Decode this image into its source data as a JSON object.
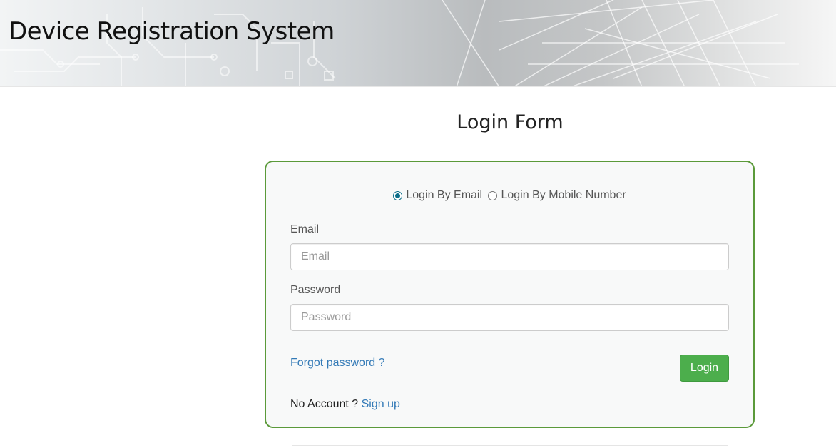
{
  "header": {
    "title": "Device Registration System"
  },
  "page": {
    "heading": "Login Form"
  },
  "login_method": {
    "options": [
      {
        "label": "Login By Email",
        "selected": true
      },
      {
        "label": "Login By Mobile Number",
        "selected": false
      }
    ]
  },
  "form": {
    "email_label": "Email",
    "email_placeholder": "Email",
    "email_value": "",
    "password_label": "Password",
    "password_placeholder": "Password",
    "password_value": "",
    "forgot_link": "Forgot password ?",
    "login_button": "Login",
    "no_account_text": "No Account ?",
    "signup_link": "Sign up"
  },
  "colors": {
    "card_border": "#5b9a3a",
    "login_button": "#4cae4c",
    "link": "#337ab7",
    "radio_accent": "#0b6e8a"
  }
}
